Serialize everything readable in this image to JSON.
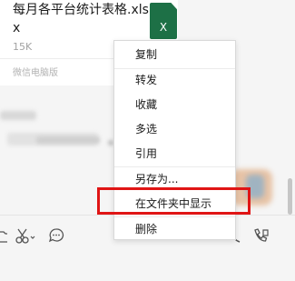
{
  "message": {
    "file_name": "每月各平台统计表格.xlsx",
    "file_size": "15K",
    "source": "微信电脑版",
    "file_type_icon_label": "X",
    "file_type_color": "#1d7046"
  },
  "context_menu": {
    "items": [
      {
        "label": "复制"
      },
      {
        "label": "转发"
      },
      {
        "label": "收藏"
      },
      {
        "label": "多选"
      },
      {
        "label": "引用"
      },
      {
        "label": "另存为..."
      },
      {
        "label": "在文件夹中显示"
      },
      {
        "label": "删除"
      }
    ],
    "highlighted_item": "在文件夹中显示",
    "highlight_color": "#e01515"
  },
  "toolbar": {
    "icons": [
      "folder-icon",
      "scissors-icon",
      "chat-bubble-icon",
      "phone-icon",
      "video-call-icon"
    ]
  }
}
